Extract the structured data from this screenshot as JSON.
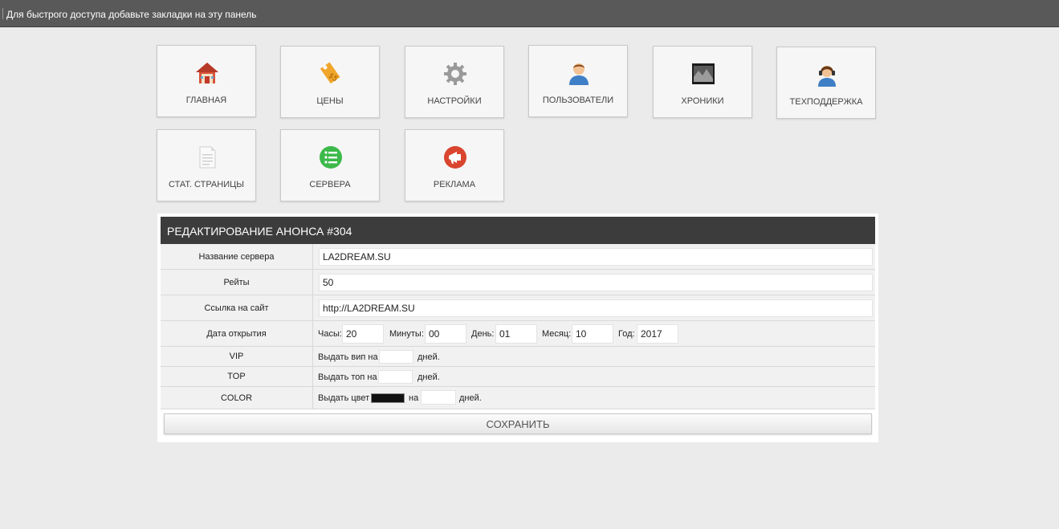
{
  "bookmarks_bar": {
    "text": "Для быстрого доступа добавьте закладки на эту панель"
  },
  "tiles": [
    {
      "label": "ГЛАВНАЯ",
      "icon": "home-icon"
    },
    {
      "label": "ЦЕНЫ",
      "icon": "price-tag-icon"
    },
    {
      "label": "НАСТРОЙКИ",
      "icon": "gear-icon"
    },
    {
      "label": "ПОЛЬЗОВАТЕЛИ",
      "icon": "user-icon"
    },
    {
      "label": "ХРОНИКИ",
      "icon": "chronicles-icon"
    },
    {
      "label": "ТЕХПОДДЕРЖКА",
      "icon": "support-icon"
    },
    {
      "label": "СТАТ. СТРАНИЦЫ",
      "icon": "page-icon"
    },
    {
      "label": "СЕРВЕРА",
      "icon": "server-list-icon"
    },
    {
      "label": "РЕКЛАМА",
      "icon": "megaphone-icon"
    }
  ],
  "form": {
    "title": "РЕДАКТИРОВАНИЕ АНОНСА #304",
    "server_name": {
      "label": "Название сервера",
      "value": "LA2DREAM.SU"
    },
    "rates": {
      "label": "Рейты",
      "value": "50"
    },
    "site": {
      "label": "Ссылка на сайт",
      "value": "http://LA2DREAM.SU"
    },
    "open_date": {
      "label": "Дата открытия",
      "hours_label": "Часы:",
      "hours": "20",
      "minutes_label": "Минуты:",
      "minutes": "00",
      "day_label": "День:",
      "day": "01",
      "month_label": "Месяц:",
      "month": "10",
      "year_label": "Год:",
      "year": "2017"
    },
    "vip": {
      "label": "VIP",
      "prefix": "Выдать вип на",
      "suffix": "дней.",
      "value": ""
    },
    "top": {
      "label": "TOP",
      "prefix": "Выдать топ на",
      "suffix": "дней.",
      "value": ""
    },
    "color": {
      "label": "COLOR",
      "prefix": "Выдать цвет",
      "mid": "на",
      "suffix": "дней.",
      "color_value": "#111111",
      "value": ""
    },
    "save_label": "СОХРАНИТЬ"
  },
  "colors": {
    "bar": "#595959",
    "panel_header": "#3c3c3c",
    "background": "#ebebeb"
  }
}
